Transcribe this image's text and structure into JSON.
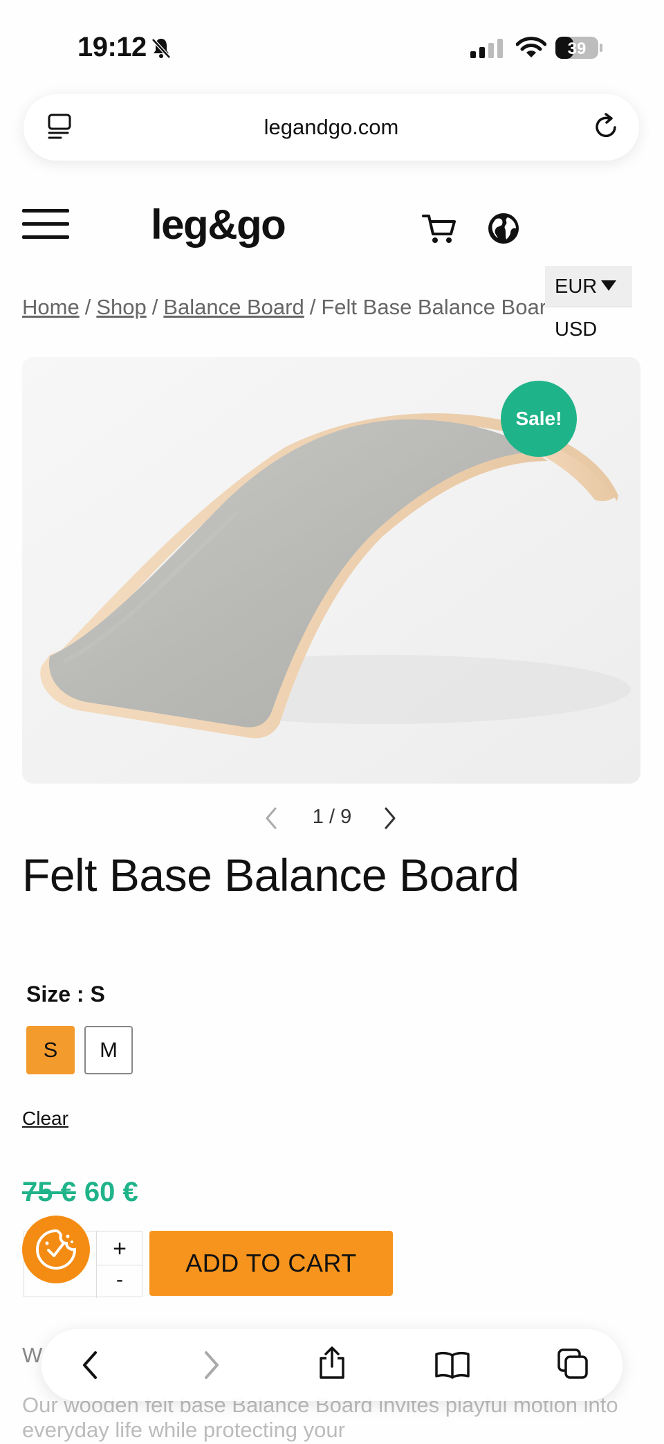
{
  "status_bar": {
    "time": "19:12",
    "battery": "39"
  },
  "browser": {
    "url": "legandgo.com"
  },
  "site": {
    "logo": "leg&go"
  },
  "breadcrumb": {
    "items": [
      "Home",
      "Shop",
      "Balance Board"
    ],
    "current": "Felt Base Balance Board",
    "separator": "/"
  },
  "currency": {
    "selected": "EUR",
    "options": [
      "USD"
    ]
  },
  "product": {
    "badge": "Sale!",
    "slider_counter": "1 / 9",
    "title": "Felt Base Balance Board",
    "size_label": "Size : S",
    "sizes": [
      "S",
      "M"
    ],
    "selected_size": "S",
    "clear_label": "Clear",
    "price_old": "75 €",
    "price_new": "60 €",
    "qty_plus": "+",
    "qty_minus": "-",
    "add_to_cart": "ADD TO CART",
    "description_heading_visible": "W",
    "description": "Our wooden felt base Balance Board invites playful motion into everyday life while protecting your"
  },
  "colors": {
    "accent_orange": "#f7941d",
    "sale_green": "#1fb389"
  }
}
